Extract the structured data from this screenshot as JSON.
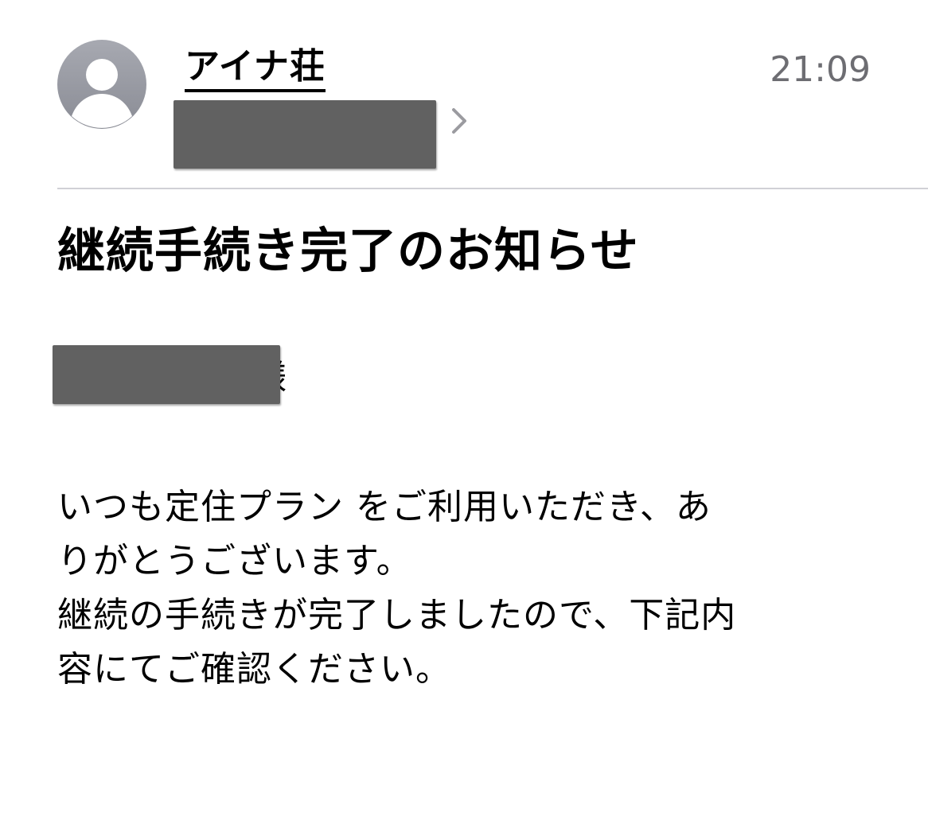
{
  "header": {
    "avatar_icon": "person-avatar-icon",
    "sender_name": "アイナ荘",
    "time": "21:09",
    "recipient_redacted": true,
    "chevron_icon": "chevron-right-icon"
  },
  "message": {
    "subject": "継続手続き完了のお知らせ",
    "salutation_suffix": "様",
    "body_lines": [
      "いつも定住プラン をご利用いただき、あ",
      "りがとうございます。",
      "継続の手続きが完了しましたので、下記内",
      "容にてご確認ください。"
    ]
  },
  "colors": {
    "time": "#6d6d72",
    "redaction": "#616161",
    "divider": "#d1d1d6",
    "avatar": "#9a9ca4"
  }
}
